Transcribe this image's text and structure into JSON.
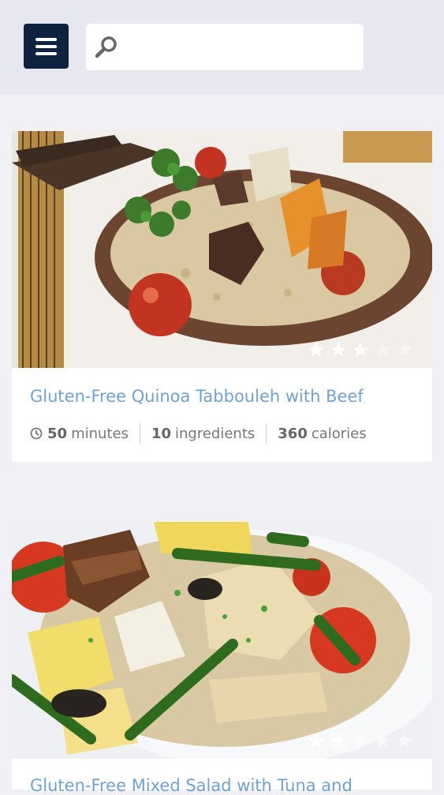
{
  "header": {
    "menu_icon": "hamburger-menu-icon",
    "search_icon": "search-icon",
    "search_placeholder": "",
    "search_value": "",
    "accent_color": "#0e2340"
  },
  "recipes": [
    {
      "title": "Gluten-Free Quinoa Tabbouleh with Beef",
      "rating": 3,
      "max_rating": 5,
      "time_value": "50",
      "time_unit": "minutes",
      "ingredients_value": "10",
      "ingredients_unit": "ingredients",
      "calories_value": "360",
      "calories_unit": "calories"
    },
    {
      "title": "Gluten-Free Mixed Salad with Tuna and",
      "rating": 2,
      "max_rating": 5
    }
  ],
  "colors": {
    "title": "#6fa3cf",
    "meta_text": "#777777",
    "page_bg": "#f0f0f5",
    "header_bg": "#e7e8ef"
  }
}
